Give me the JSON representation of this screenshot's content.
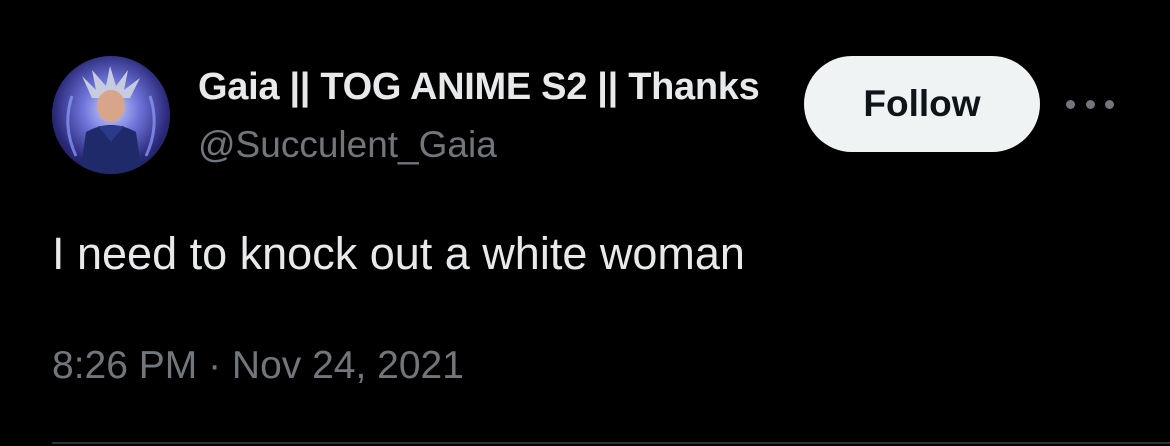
{
  "tweet": {
    "author": {
      "display_name": "Gaia || TOG ANIME S2 || Thanks",
      "handle": "@Succulent_Gaia",
      "avatar_icon": "anime-character-avatar"
    },
    "follow_label": "Follow",
    "more_icon": "more-options-icon",
    "text": "I need to knock out a white woman",
    "timestamp": "8:26 PM · Nov 24, 2021"
  },
  "colors": {
    "background": "#000000",
    "primary_text": "#e7e9ea",
    "secondary_text": "#71767b",
    "follow_bg": "#eff3f4",
    "follow_text": "#0f1419"
  }
}
